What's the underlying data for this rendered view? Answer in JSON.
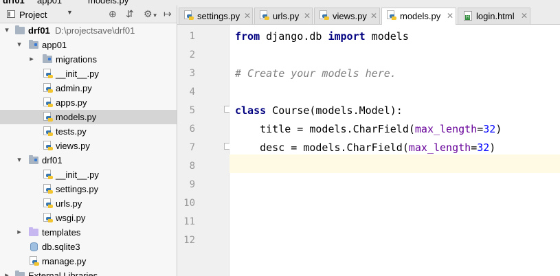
{
  "breadcrumbs": [
    "drf01",
    "app01",
    "models.py"
  ],
  "project_panel": {
    "title": "Project",
    "tree": [
      {
        "label": "drf01",
        "path": "D:\\projectsave\\drf01",
        "type": "root",
        "expanded": true
      },
      {
        "label": "app01",
        "type": "package",
        "expanded": true
      },
      {
        "label": "migrations",
        "type": "package",
        "expanded": false
      },
      {
        "label": "__init__.py",
        "type": "py"
      },
      {
        "label": "admin.py",
        "type": "py"
      },
      {
        "label": "apps.py",
        "type": "py"
      },
      {
        "label": "models.py",
        "type": "py",
        "selected": true
      },
      {
        "label": "tests.py",
        "type": "py"
      },
      {
        "label": "views.py",
        "type": "py"
      },
      {
        "label": "drf01",
        "type": "package",
        "expanded": true
      },
      {
        "label": "__init__.py",
        "type": "py"
      },
      {
        "label": "settings.py",
        "type": "py"
      },
      {
        "label": "urls.py",
        "type": "py"
      },
      {
        "label": "wsgi.py",
        "type": "py"
      },
      {
        "label": "templates",
        "type": "folder-template",
        "expanded": false
      },
      {
        "label": "db.sqlite3",
        "type": "db"
      },
      {
        "label": "manage.py",
        "type": "py"
      },
      {
        "label": "External Libraries",
        "type": "lib"
      }
    ]
  },
  "tabs": [
    {
      "label": "settings.py",
      "type": "py",
      "active": false
    },
    {
      "label": "urls.py",
      "type": "py",
      "active": false
    },
    {
      "label": "views.py",
      "type": "py",
      "active": false
    },
    {
      "label": "models.py",
      "type": "py",
      "active": true
    },
    {
      "label": "login.html",
      "type": "html",
      "active": false
    }
  ],
  "editor": {
    "line_numbers": [
      "1",
      "2",
      "3",
      "4",
      "5",
      "6",
      "7",
      "8",
      "9",
      "10",
      "11",
      "12"
    ],
    "current_line": 8,
    "lines": [
      {
        "t1": "from",
        "t2": " django.db ",
        "t3": "import",
        "t4": " models"
      },
      {},
      {
        "comment": "# Create your models here."
      },
      {},
      {
        "t1": "class",
        "t2": " Course(models.Model):"
      },
      {
        "a": "    title = models.CharField(",
        "p": "max_length",
        "eq": "=",
        "n": "32",
        "e": ")"
      },
      {
        "a": "    desc = models.CharField(",
        "p": "max_length",
        "eq": "=",
        "n": "32",
        "e": ")"
      }
    ]
  },
  "colors": {
    "keyword": "#000080",
    "comment": "#808080",
    "param": "#660099",
    "number": "#0000ff",
    "current_line": "#fffae3",
    "selection": "#d5d5d5"
  }
}
